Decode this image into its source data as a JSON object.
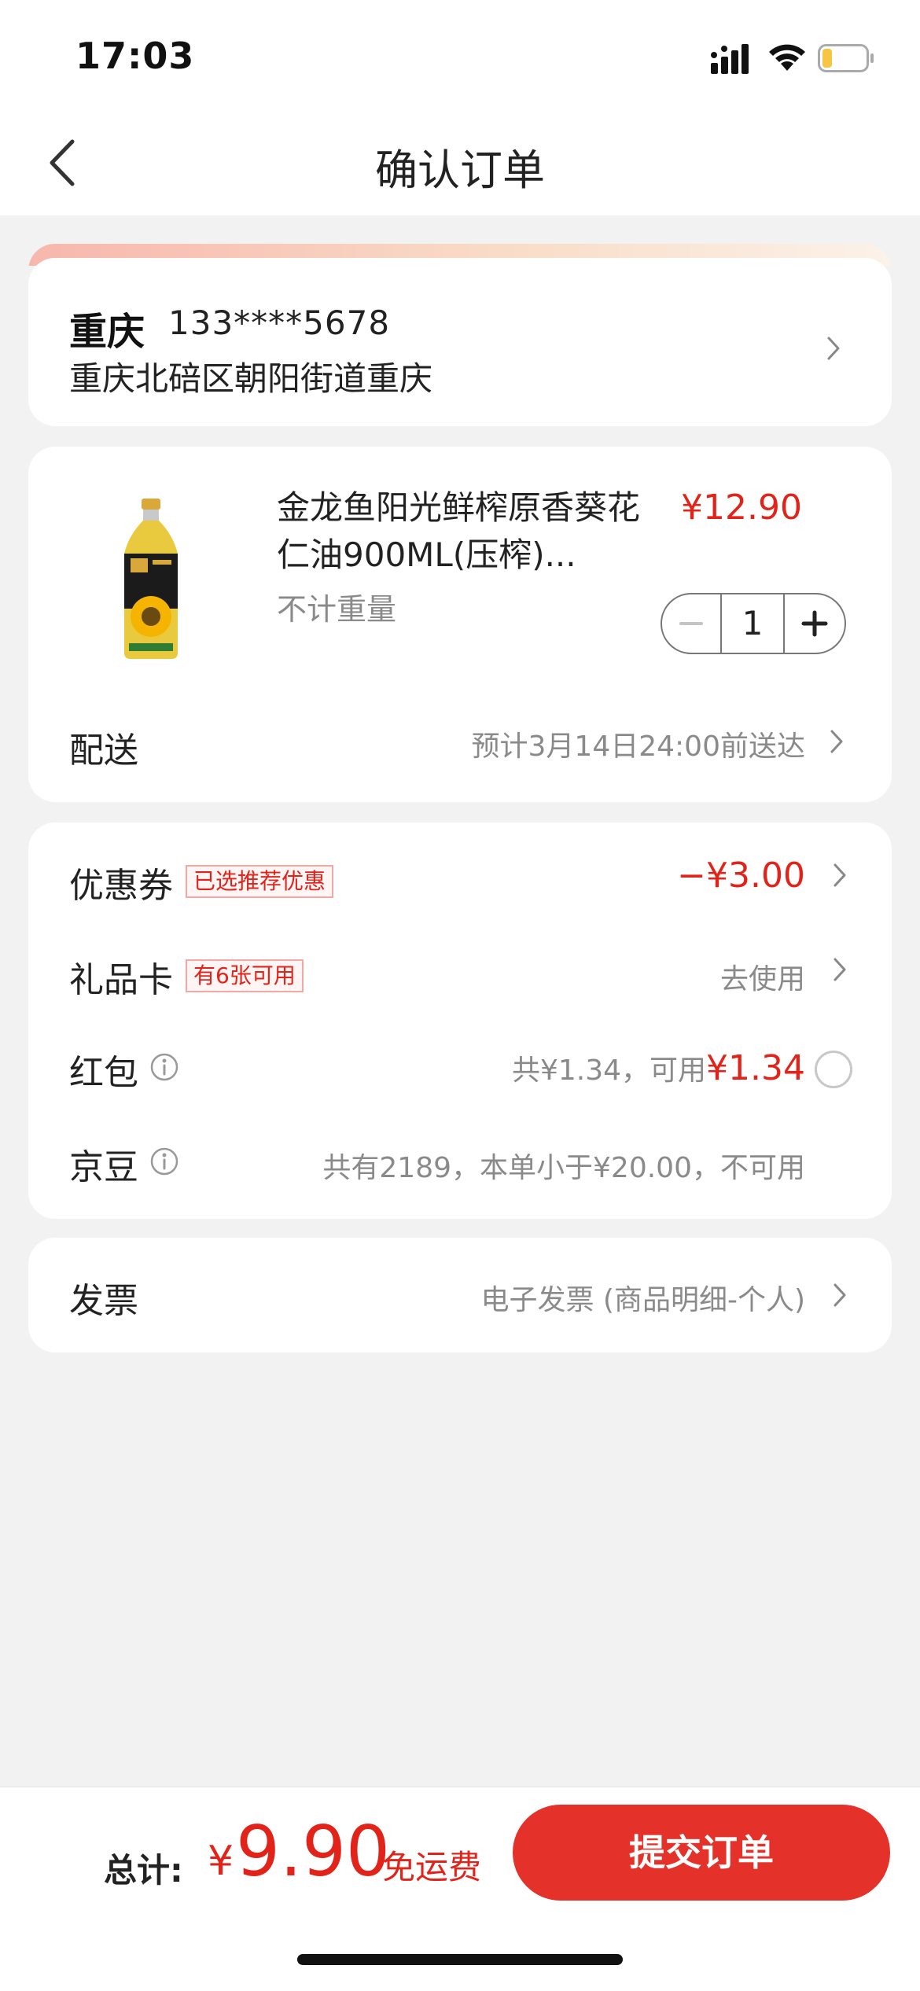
{
  "status_bar": {
    "time": "17:03"
  },
  "nav": {
    "title": "确认订单"
  },
  "address": {
    "city": "重庆",
    "phone": "133****5678",
    "detail": "重庆北碚区朝阳街道重庆"
  },
  "goods": {
    "name": "金龙鱼阳光鲜榨原香葵花仁油900ML(压榨)...",
    "price": "¥12.90",
    "weight_note": "不计重量",
    "quantity": "1",
    "shipping_label": "配送",
    "shipping_eta": "预计3月14日24:00前送达"
  },
  "benefits": {
    "coupon": {
      "label": "优惠券",
      "tag": "已选推荐优惠",
      "value": "−¥3.00"
    },
    "gift_card": {
      "label": "礼品卡",
      "tag": "有6张可用",
      "value": "去使用"
    },
    "red_packet": {
      "label": "红包",
      "value_prefix": "共¥1.34，可用",
      "value_amount": "¥1.34"
    },
    "jd_beans": {
      "label": "京豆",
      "value": "共有2189，本单小于¥20.00，不可用"
    }
  },
  "invoice": {
    "label": "发票",
    "value": "电子发票 (商品明细-个人)"
  },
  "footer": {
    "total_label": "总计:",
    "currency": "¥",
    "total_amount": "9.90",
    "shipping_note": "免运费",
    "submit_label": "提交订单"
  },
  "colors": {
    "accent_red": "#e2231a",
    "button_red": "#e4322a",
    "background": "#f2f2f2"
  }
}
